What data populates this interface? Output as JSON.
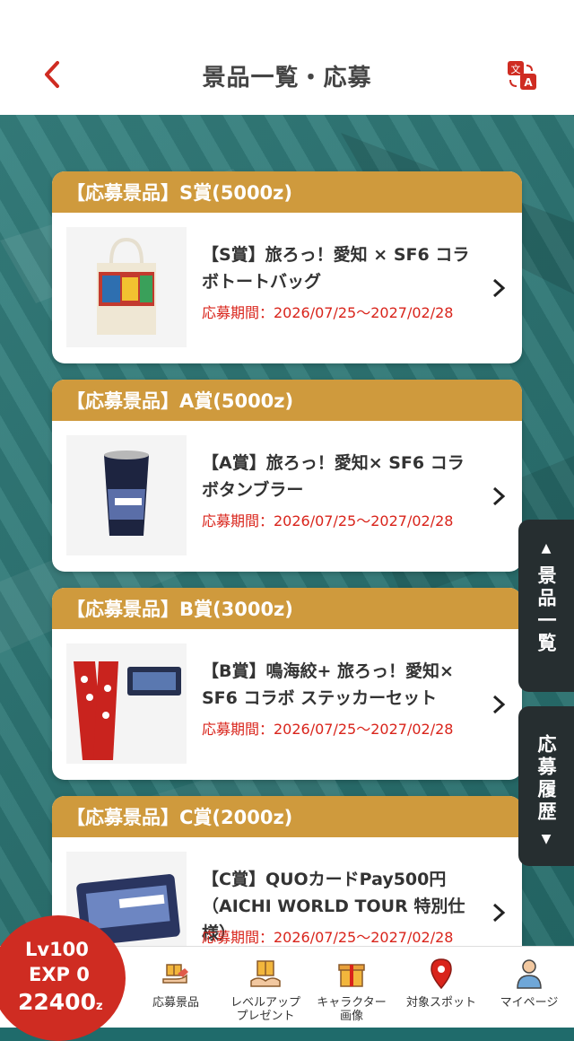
{
  "header": {
    "title": "景品一覧・応募"
  },
  "prizes": [
    {
      "category": "【応募景品】S賞(5000z)",
      "name": "【S賞】旅ろっ！愛知 × SF6 コラボトートバッグ",
      "period": "応募期間：2026/07/25〜2027/02/28",
      "thumb": "tote-bag"
    },
    {
      "category": "【応募景品】A賞(5000z)",
      "name": "【A賞】旅ろっ！愛知× SF6 コラボタンブラー",
      "period": "応募期間：2026/07/25〜2027/02/28",
      "thumb": "tumbler"
    },
    {
      "category": "【応募景品】B賞(3000z)",
      "name": "【B賞】鳴海絞+ 旅ろっ！愛知× SF6 コラボ ステッカーセット",
      "period": "応募期間：2026/07/25〜2027/02/28",
      "thumb": "sticker-set"
    },
    {
      "category": "【応募景品】C賞(2000z)",
      "name": "【C賞】QUOカードPay500円（AICHI WORLD TOUR 特別仕様）",
      "period": "応募期間：2026/07/25〜2027/02/28",
      "thumb": "quo-card"
    }
  ],
  "side_tabs": {
    "catalog": "景品一覧",
    "history": "応募履歴"
  },
  "level_badge": {
    "level": "Lv100",
    "exp": "EXP 0",
    "points": "22400",
    "unit": "z"
  },
  "tabbar": [
    {
      "label": "応募景品",
      "icon": "gift-hand-icon"
    },
    {
      "label": "レベルアップ\nプレゼント",
      "icon": "present-hand-icon"
    },
    {
      "label": "キャラクター\n画像",
      "icon": "gift-box-icon"
    },
    {
      "label": "対象スポット",
      "icon": "map-pin-icon"
    },
    {
      "label": "マイページ",
      "icon": "user-icon"
    }
  ],
  "colors": {
    "accent": "#cf2c22",
    "card_header": "#cf9a3d",
    "period_red": "#d9241b",
    "background": "#2a7a78"
  }
}
